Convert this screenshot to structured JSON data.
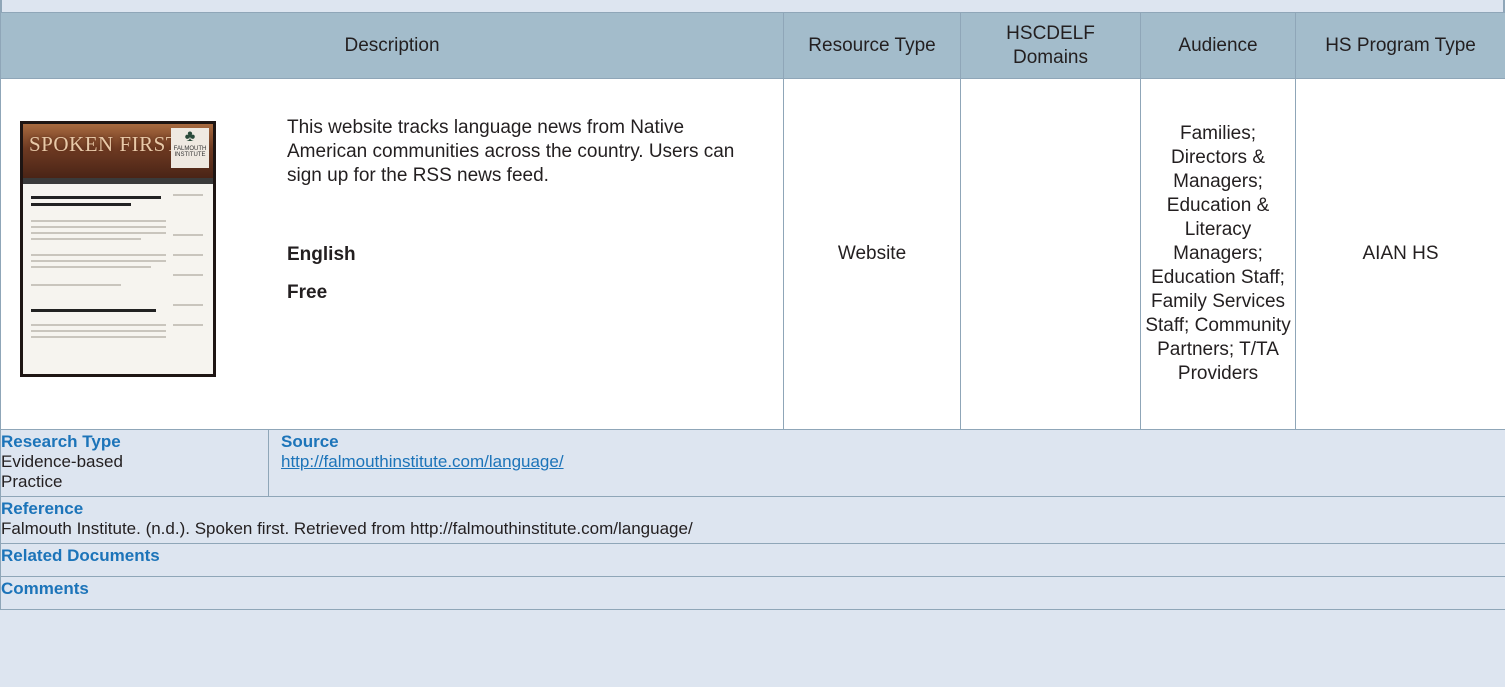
{
  "header": {
    "description": "Description",
    "resource_type": "Resource Type",
    "domains": "HSCDELF Domains",
    "audience": "Audience",
    "program_type": "HS Program Type"
  },
  "resource": {
    "thumbnail": {
      "title": "SPOKEN FIRST",
      "logo_text": "FALMOUTH INSTITUTE"
    },
    "description": "This website tracks language news from Native American communities across the country. Users can sign up for the RSS news feed.",
    "language": "English",
    "cost": "Free",
    "resource_type": "Website",
    "domains": "",
    "audience": "Families; Directors & Managers; Education & Literacy Managers; Education Staff; Family Services Staff; Community Partners; T/TA Providers",
    "program_type": "AIAN HS"
  },
  "research_type": {
    "label": "Research Type",
    "value": "Evidence-based Practice"
  },
  "source": {
    "label": "Source",
    "url": "http://falmouthinstitute.com/language/"
  },
  "reference": {
    "label": "Reference",
    "value": "Falmouth Institute. (n.d.). Spoken first. Retrieved from http://falmouthinstitute.com/language/"
  },
  "related_documents": {
    "label": "Related Documents"
  },
  "comments": {
    "label": "Comments"
  },
  "colors": {
    "header_bg": "#a3bccb",
    "panel_bg": "#dde5f0",
    "border": "#8fa6b8",
    "label_blue": "#1c74b9"
  }
}
